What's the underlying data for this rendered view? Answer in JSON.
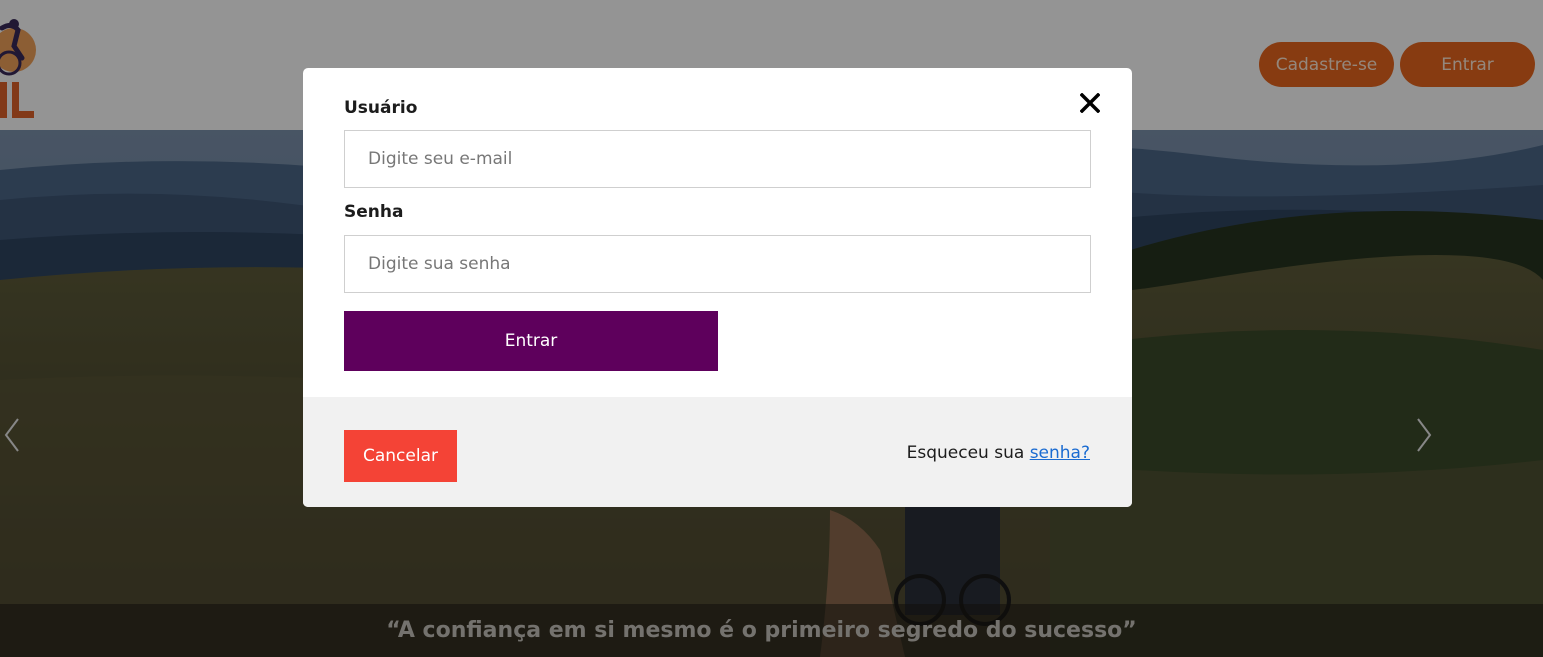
{
  "header": {
    "register_label": "Cadastre-se",
    "login_label": "Entrar"
  },
  "hero": {
    "quote": "“A confiança em si mesmo é o primeiro segredo do sucesso”"
  },
  "modal": {
    "user_label": "Usuário",
    "user_placeholder": "Digite seu e-mail",
    "user_value": "",
    "password_label": "Senha",
    "password_placeholder": "Digite sua senha",
    "password_value": "",
    "submit_label": "Entrar",
    "cancel_label": "Cancelar",
    "forgot_text": "Esqueceu sua",
    "forgot_link": "senha?"
  },
  "icons": {
    "close": "close-icon",
    "prev": "chevron-left-icon",
    "next": "chevron-right-icon",
    "logo": "cyclist-logo"
  },
  "colors": {
    "nav_button": "#e8671e",
    "submit_button": "#5e005c",
    "cancel_button": "#f44336",
    "link": "#1a6bd1",
    "footer_bg": "#f1f1f1"
  }
}
